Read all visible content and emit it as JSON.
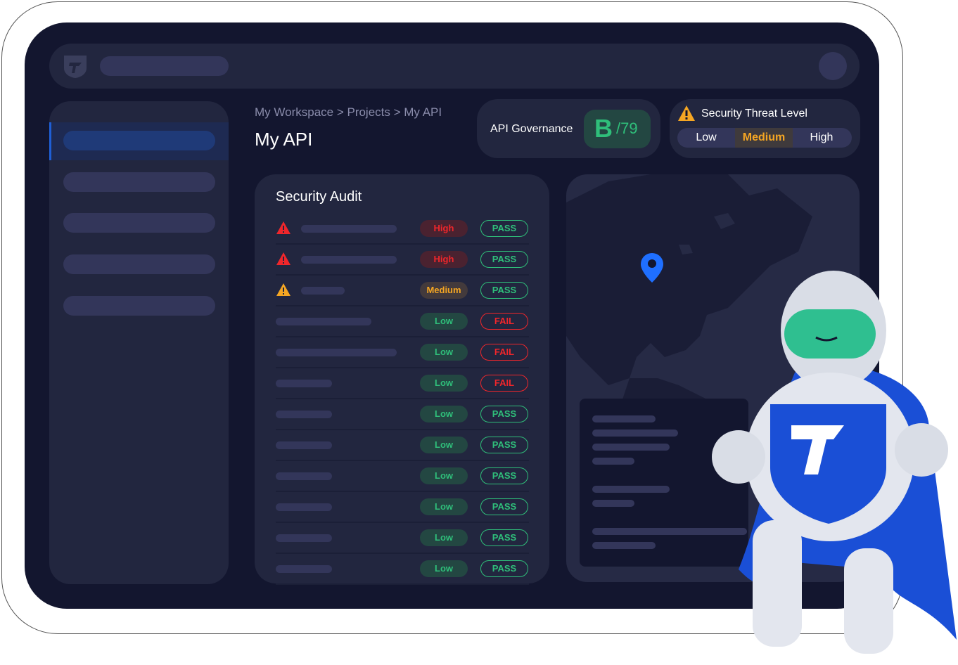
{
  "breadcrumb": "My Workspace > Projects > My API",
  "page_title": "My API",
  "governance": {
    "label": "API Governance",
    "grade": "B",
    "score": "/79"
  },
  "threat": {
    "title": "Security Threat Level",
    "options": [
      "Low",
      "Medium",
      "High"
    ],
    "selected": "Medium"
  },
  "audit": {
    "title": "Security Audit",
    "rows": [
      {
        "icon": "warning-red",
        "severity": "High",
        "result": "PASS"
      },
      {
        "icon": "warning-red",
        "severity": "High",
        "result": "PASS"
      },
      {
        "icon": "warning-orange",
        "severity": "Medium",
        "result": "PASS"
      },
      {
        "icon": "",
        "severity": "Low",
        "result": "FAIL"
      },
      {
        "icon": "",
        "severity": "Low",
        "result": "FAIL"
      },
      {
        "icon": "",
        "severity": "Low",
        "result": "FAIL"
      },
      {
        "icon": "",
        "severity": "Low",
        "result": "PASS"
      },
      {
        "icon": "",
        "severity": "Low",
        "result": "PASS"
      },
      {
        "icon": "",
        "severity": "Low",
        "result": "PASS"
      },
      {
        "icon": "",
        "severity": "Low",
        "result": "PASS"
      },
      {
        "icon": "",
        "severity": "Low",
        "result": "PASS"
      },
      {
        "icon": "",
        "severity": "Low",
        "result": "PASS"
      }
    ]
  },
  "colors": {
    "high": "#f0262b",
    "medium": "#f5a623",
    "low": "#2fbf7a",
    "accent": "#1f6fff"
  }
}
